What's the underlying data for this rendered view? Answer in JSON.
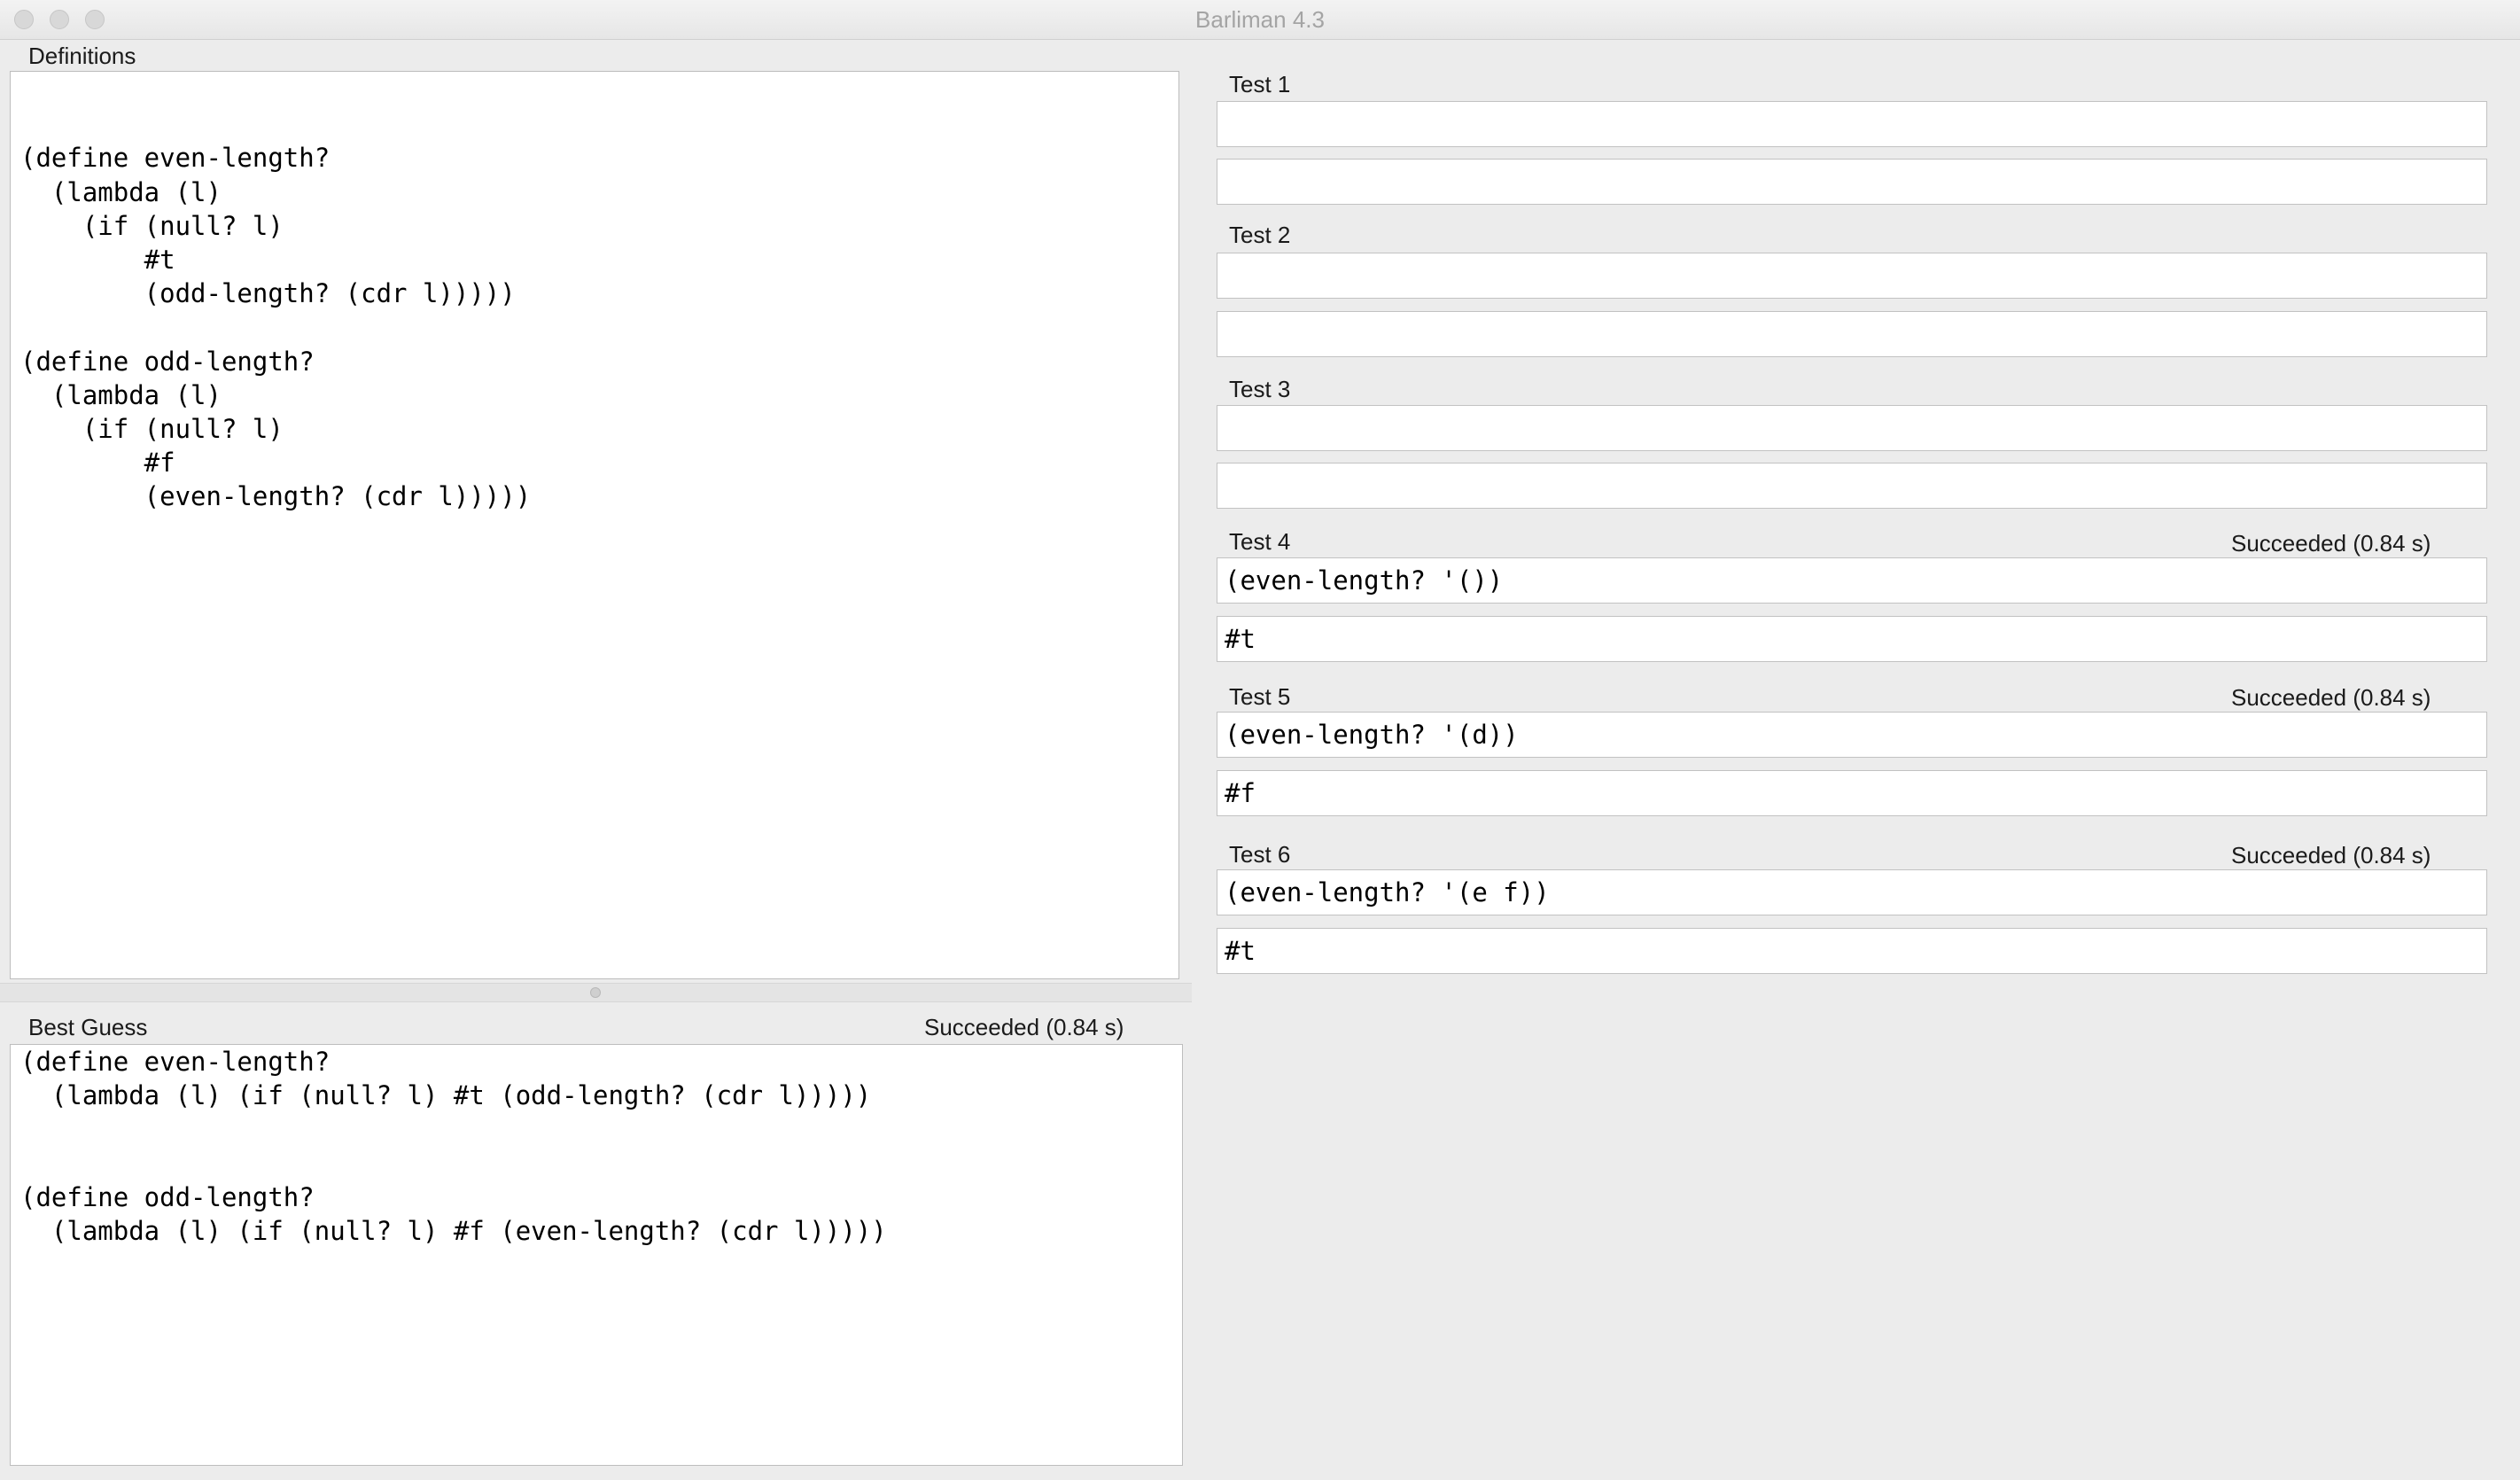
{
  "window": {
    "title": "Barliman 4.3"
  },
  "definitions": {
    "label": "Definitions",
    "code": "\n\n(define even-length?\n  (lambda (l)\n    (if (null? l)\n        #t\n        (odd-length? (cdr l)))))\n\n(define odd-length?\n  (lambda (l)\n    (if (null? l)\n        #f\n        (even-length? (cdr l)))))"
  },
  "best_guess": {
    "label": "Best Guess",
    "status": "Succeeded (0.84 s)",
    "code": "(define even-length?\n  (lambda (l) (if (null? l) #t (odd-length? (cdr l)))))\n\n\n(define odd-length?\n  (lambda (l) (if (null? l) #f (even-length? (cdr l)))))"
  },
  "tests": [
    {
      "label": "Test 1",
      "status": "",
      "input": "",
      "output": ""
    },
    {
      "label": "Test 2",
      "status": "",
      "input": "",
      "output": ""
    },
    {
      "label": "Test 3",
      "status": "",
      "input": "",
      "output": ""
    },
    {
      "label": "Test 4",
      "status": "Succeeded (0.84 s)",
      "input": "(even-length? '())",
      "output": "#t"
    },
    {
      "label": "Test 5",
      "status": "Succeeded (0.84 s)",
      "input": "(even-length? '(d))",
      "output": "#f"
    },
    {
      "label": "Test 6",
      "status": "Succeeded (0.84 s)",
      "input": "(even-length? '(e f))",
      "output": "#t"
    }
  ]
}
